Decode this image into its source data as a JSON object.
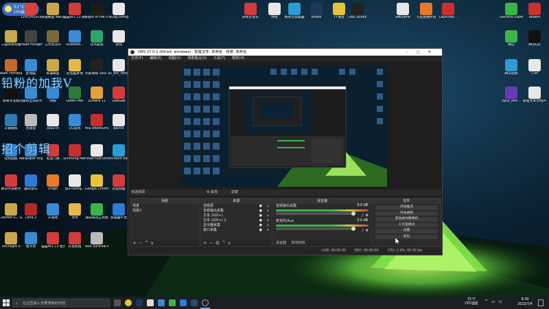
{
  "colors": {
    "accent": "#3bb54a",
    "window_bg": "#1e1e1e",
    "taskbar": "#1a1f24"
  },
  "weather": {
    "temp": "51°C",
    "label": "CPU温度"
  },
  "overlay": {
    "line1": "铅粉的加我V",
    "line2": "招个剪辑"
  },
  "desktop_left": [
    {
      "label": "1145141919",
      "icon": "chart-icon",
      "color": "#d94040"
    },
    {
      "label": "英雄联盟 WeGame版",
      "icon": "lol-icon",
      "color": "#c9a84a"
    },
    {
      "label": "猫猫Ar1.13 离线射版",
      "icon": "app-icon",
      "color": "#d23c3c"
    },
    {
      "label": "Night of the Dead",
      "icon": "game-icon",
      "color": "#1c1c1c"
    },
    {
      "label": "NLog.config",
      "icon": "file-icon",
      "color": "#e8e8e8"
    },
    {
      "label": "三国杀移动版",
      "icon": "game-icon",
      "color": "#c9a84a"
    },
    {
      "label": "Dread Hunger",
      "icon": "game-icon",
      "color": "#444"
    },
    {
      "label": "艾尔登法环",
      "icon": "game-icon",
      "color": "#7a6a3a"
    },
    {
      "label": "Shadows...",
      "icon": "send-icon",
      "color": "#3a8ad6"
    },
    {
      "label": "双点医院",
      "icon": "game-icon",
      "color": "#2ea36a"
    },
    {
      "label": "游戏",
      "icon": "folder-icon",
      "color": "#e8e8e8"
    },
    {
      "label": "Team Fortress 2",
      "icon": "game-icon",
      "color": "#c46a2a"
    },
    {
      "label": "此电脑",
      "icon": "pc-icon",
      "color": "#3a8ad6"
    },
    {
      "label": "英雄联盟",
      "icon": "lol-icon",
      "color": "#c9a84a"
    },
    {
      "label": "此电脑本地",
      "icon": "folder-icon",
      "color": "#e6b84a"
    },
    {
      "label": "奈斯网络 Soul ...",
      "icon": "app-icon",
      "color": "#222"
    },
    {
      "label": "ss_win_temp",
      "icon": "file-icon",
      "color": "#e8e8e8"
    },
    {
      "label": "剪映专业版",
      "icon": "capcut-icon",
      "color": "#111"
    },
    {
      "label": "创建的全局转大全图",
      "icon": "file-icon",
      "color": "#3a8ad6"
    },
    {
      "label": "网络",
      "icon": "network-icon",
      "color": "#3a8ad6"
    },
    {
      "label": "Green Hell",
      "icon": "game-icon",
      "color": "#2e7a3a"
    },
    {
      "label": "3DMark 11",
      "icon": "app-icon",
      "color": "#e6a03a"
    },
    {
      "label": "GeeGee",
      "icon": "app-icon",
      "color": "#d23c3c"
    },
    {
      "label": "开箱模拟",
      "icon": "app-icon",
      "color": "#2e7ab5"
    },
    {
      "label": "回收站",
      "icon": "recycle-icon",
      "color": "#bbb"
    },
    {
      "label": "cpuz.cn",
      "icon": "file-icon",
      "color": "#e8e8e8"
    },
    {
      "label": "QQ游戏",
      "icon": "qq-icon",
      "color": "#3a8ad6"
    },
    {
      "label": "MSI Afterburner",
      "icon": "app-icon",
      "color": "#c83030"
    },
    {
      "label": "pactxt",
      "icon": "file-icon",
      "color": "#e8e8e8"
    },
    {
      "label": "控制面板",
      "icon": "settings-icon",
      "color": "#3a8ad6"
    },
    {
      "label": "Wallpaper Engine:...",
      "icon": "app-icon",
      "color": "#3a8ad6"
    },
    {
      "label": "电话八阀",
      "icon": "app-icon",
      "color": "#d23c3c"
    },
    {
      "label": "Surviving Mars",
      "icon": "game-icon",
      "color": "#c83030"
    },
    {
      "label": "user-rule.txt",
      "icon": "file-icon",
      "color": "#e8e8e8"
    },
    {
      "label": "Microsoft Edge",
      "icon": "edge-icon",
      "color": "#2e9ad6"
    },
    {
      "label": "腾讯手游助手",
      "icon": "app-icon",
      "color": "#d23c3c"
    },
    {
      "label": "酷狗音乐",
      "icon": "kugou-icon",
      "color": "#2e7ad6"
    },
    {
      "label": "Origin",
      "icon": "origin-icon",
      "color": "#e67a2a"
    },
    {
      "label": "gui-config...",
      "icon": "file-icon",
      "color": "#e8e8e8"
    },
    {
      "label": "Google Chrome",
      "icon": "chrome-icon",
      "color": "#e8c43a"
    },
    {
      "label": "百度网盘",
      "icon": "app-icon",
      "color": "#d23c3c"
    },
    {
      "label": "Counter-S... Global Off...",
      "icon": "game-icon",
      "color": "#c9a84a"
    },
    {
      "label": "Dota 2",
      "icon": "game-icon",
      "color": "#b02a2a"
    },
    {
      "label": "开黑啦",
      "icon": "app-icon",
      "color": "#3a8ad6"
    },
    {
      "label": "文件",
      "icon": "folder-icon",
      "color": "#e6b84a"
    },
    {
      "label": "海岛奇兵正式版",
      "icon": "game-icon",
      "color": "#3ab54a"
    },
    {
      "label": "加速器平台",
      "icon": "app-icon",
      "color": "#2e7ad6"
    },
    {
      "label": "Torchlight II",
      "icon": "game-icon",
      "color": "#c9a84a"
    },
    {
      "label": "鲁大师",
      "icon": "app-icon",
      "color": "#3a8ad6"
    },
    {
      "label": "猫猫Ar1.13 整合包",
      "icon": "app-icon",
      "color": "#d23c3c"
    },
    {
      "label": "开黑机组",
      "icon": "app-icon",
      "color": "#d23c3c"
    },
    {
      "label": "ARK Survival Evolved",
      "icon": "game-icon",
      "color": "#bbb"
    }
  ],
  "desktop_top": [
    {
      "label": "网易云音乐",
      "icon": "netease-icon",
      "color": "#d23c3c"
    },
    {
      "label": "绿色",
      "icon": "app-icon",
      "color": "#e8e8e8"
    },
    {
      "label": "网易云加速器",
      "icon": "app-icon",
      "color": "#2e9ad6"
    },
    {
      "label": "steam",
      "icon": "steam-icon",
      "color": "#1b3a5a"
    },
    {
      "label": "YY语音",
      "icon": "yy-icon",
      "color": "#e6c43a"
    },
    {
      "label": "OBS Studio",
      "icon": "obs-icon",
      "color": "#222"
    },
    {
      "label": "WeGame",
      "icon": "wegame-icon",
      "color": "#e8e8e8"
    },
    {
      "label": "斗鱼直播伴侣",
      "icon": "douyu-icon",
      "color": "#e67a2a"
    },
    {
      "label": "Launcher...",
      "icon": "app-icon",
      "color": "#c83030"
    }
  ],
  "desktop_right": [
    {
      "label": "GeForce Experience",
      "icon": "nvidia-icon",
      "color": "#3ab54a"
    },
    {
      "label": "aida64",
      "icon": "aida-icon",
      "color": "#c83030"
    },
    {
      "label": "微信",
      "icon": "wechat-icon",
      "color": "#3ab54a"
    },
    {
      "label": "腾讯QQ",
      "icon": "qq-icon",
      "color": "#111"
    },
    {
      "label": "腾讯视频",
      "icon": "video-icon",
      "color": "#2e9ad6"
    },
    {
      "label": "cpuz_x64...",
      "icon": "cpu-icon",
      "color": "#6a3ab5"
    },
    {
      "label": "Cfxt",
      "icon": "file-icon",
      "color": "#e8e8e8"
    },
    {
      "label": "新建文本文档(4).txt",
      "icon": "file-icon",
      "color": "#e8e8e8"
    }
  ],
  "obs": {
    "title": "OBS 27.0.1 (64-bit, windows) - 配置文件: 未命名 - 场景: 未命名",
    "menu": [
      "文件(F)",
      "编辑(E)",
      "视图(V)",
      "场景集合(S)",
      "工具(T)",
      "帮助(H)"
    ],
    "source_bar": "未选择源",
    "source_bar_props": "⚙ 属性",
    "source_bar_filters": "滤镜",
    "scenes_title": "场景",
    "scenes": [
      "场景",
      "场景2"
    ],
    "sources_title": "来源",
    "sources": [
      "音频源",
      "音频输出采集",
      "文本 (GDI+)",
      "文本 (GDI+) 2",
      "显示器采集",
      "窗口采集"
    ],
    "mixer_title": "混音器",
    "mixer": [
      {
        "name": "音频输出采集",
        "db": "0.0 dB"
      },
      {
        "name": "麦克风/Aux",
        "db": "0.0 dB"
      }
    ],
    "mixer_tabs": [
      "混音器",
      "转场特效"
    ],
    "controls_title": "控件",
    "controls": [
      "开始推流",
      "开始录制",
      "启动虚拟摄像机",
      "工作室模式",
      "设置",
      "退出"
    ],
    "status": {
      "live": "LIVE: 00:00:00",
      "rec": "REC: 00:00:00",
      "cpu": "CPU: 2.4%, 60.00 fps"
    }
  },
  "taskbar": {
    "search_placeholder": "在这里输入你要搜索的内容",
    "cpu_temp": "51°C",
    "cpu_label": "CPU温度",
    "time": "6:30",
    "date": "2022/7/4"
  }
}
